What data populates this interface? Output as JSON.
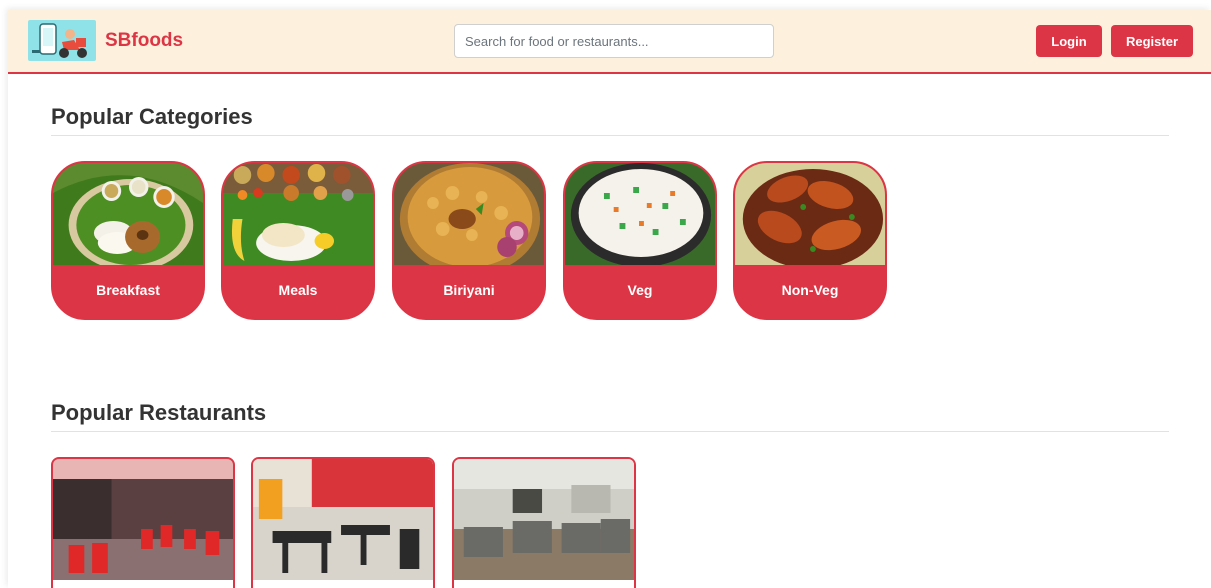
{
  "navbar": {
    "brand": "SBfoods",
    "search_placeholder": "Search for food or restaurants...",
    "login_label": "Login",
    "register_label": "Register"
  },
  "categories_section": {
    "title": "Popular Categories",
    "items": [
      {
        "label": "Breakfast"
      },
      {
        "label": "Meals"
      },
      {
        "label": "Biriyani"
      },
      {
        "label": "Veg"
      },
      {
        "label": "Non-Veg"
      }
    ]
  },
  "restaurants_section": {
    "title": "Popular Restaurants",
    "items": [
      {
        "image": "restaurant-interior-red-chairs"
      },
      {
        "image": "restaurant-interior-red-wall"
      },
      {
        "image": "restaurant-interior-steel-chairs"
      }
    ]
  },
  "colors": {
    "accent": "#dc3545",
    "navbar_bg": "#fdf0dc",
    "logo_bg": "#8fe3e8"
  }
}
